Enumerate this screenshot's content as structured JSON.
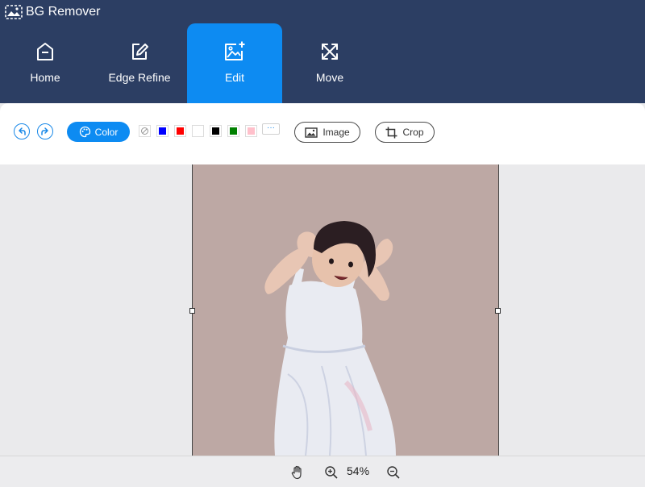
{
  "app": {
    "title": "BG Remover"
  },
  "nav": {
    "tabs": [
      {
        "label": "Home",
        "icon": "home-icon"
      },
      {
        "label": "Edge Refine",
        "icon": "edit-icon"
      },
      {
        "label": "Edit",
        "icon": "image-edit-icon",
        "active": true
      },
      {
        "label": "Move",
        "icon": "move-arrows-icon"
      }
    ]
  },
  "toolbar": {
    "undo_icon": "undo-icon",
    "redo_icon": "redo-icon",
    "color_label": "Color",
    "swatches": [
      "none",
      "#0000ff",
      "#ff0000",
      "#ffffff",
      "#000000",
      "#008000",
      "#ffc0cb"
    ],
    "more_label": "···",
    "image_label": "Image",
    "crop_label": "Crop"
  },
  "canvas": {
    "background_color": "#bda8a4"
  },
  "footer": {
    "zoom": "54%"
  },
  "colors": {
    "header": "#2c3e63",
    "accent": "#0d8bf2"
  }
}
